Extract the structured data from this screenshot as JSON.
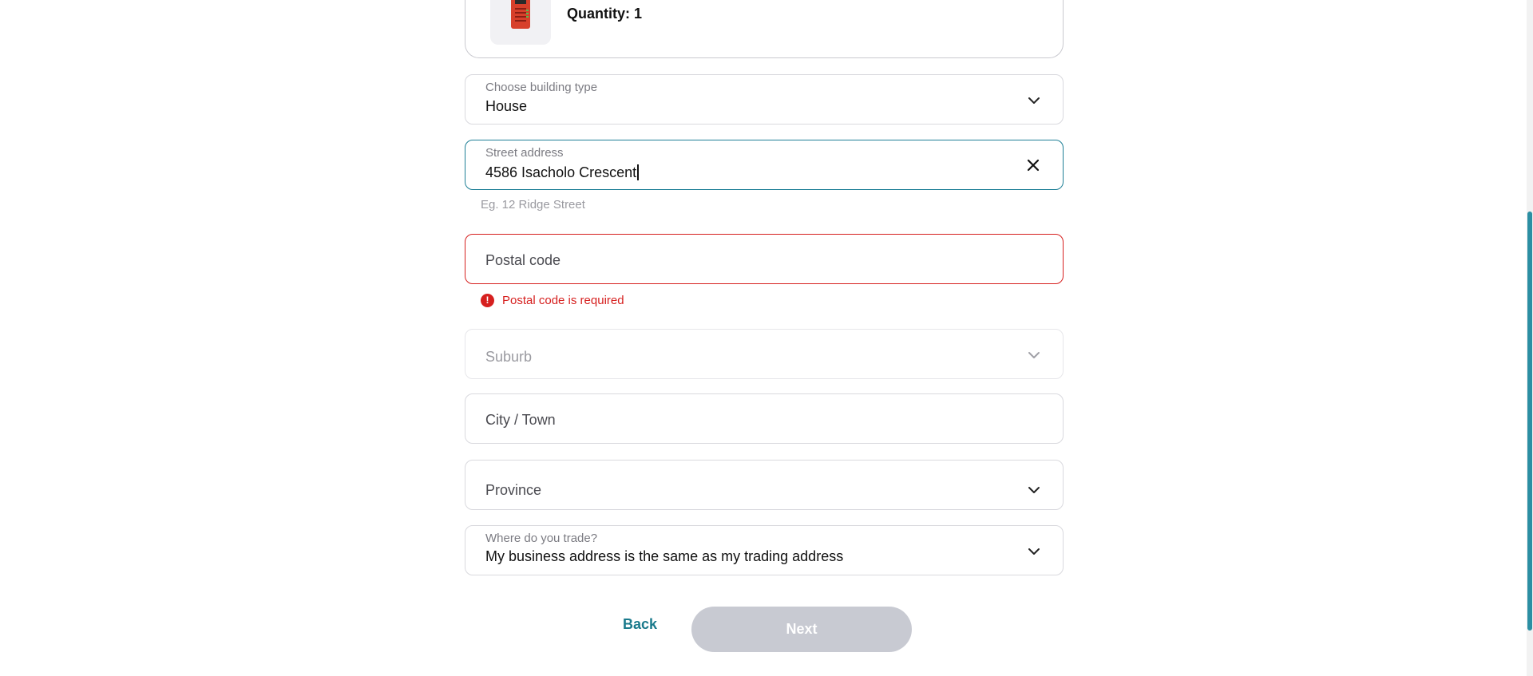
{
  "product": {
    "quantity_label": "Quantity: 1"
  },
  "form": {
    "building_type": {
      "label": "Choose building type",
      "value": "House"
    },
    "street_address": {
      "label": "Street address",
      "value": "4586 Isacholo Crescent",
      "helper": "Eg. 12 Ridge Street"
    },
    "postal_code": {
      "placeholder": "Postal code",
      "error": "Postal code is required"
    },
    "suburb": {
      "placeholder": "Suburb"
    },
    "city": {
      "placeholder": "City / Town"
    },
    "province": {
      "placeholder": "Province"
    },
    "trade_location": {
      "label": "Where do you trade?",
      "value": "My business address is the same as my trading address"
    }
  },
  "actions": {
    "back_label": "Back",
    "next_label": "Next"
  },
  "colors": {
    "accent": "#1a7a8c",
    "active_border": "#1e7f96",
    "error": "#d6201f",
    "disabled_button": "#c8cad2"
  },
  "icons": {
    "dropdown": "chevron-down-icon",
    "clear": "close-icon",
    "error": "exclamation-circle-icon"
  }
}
